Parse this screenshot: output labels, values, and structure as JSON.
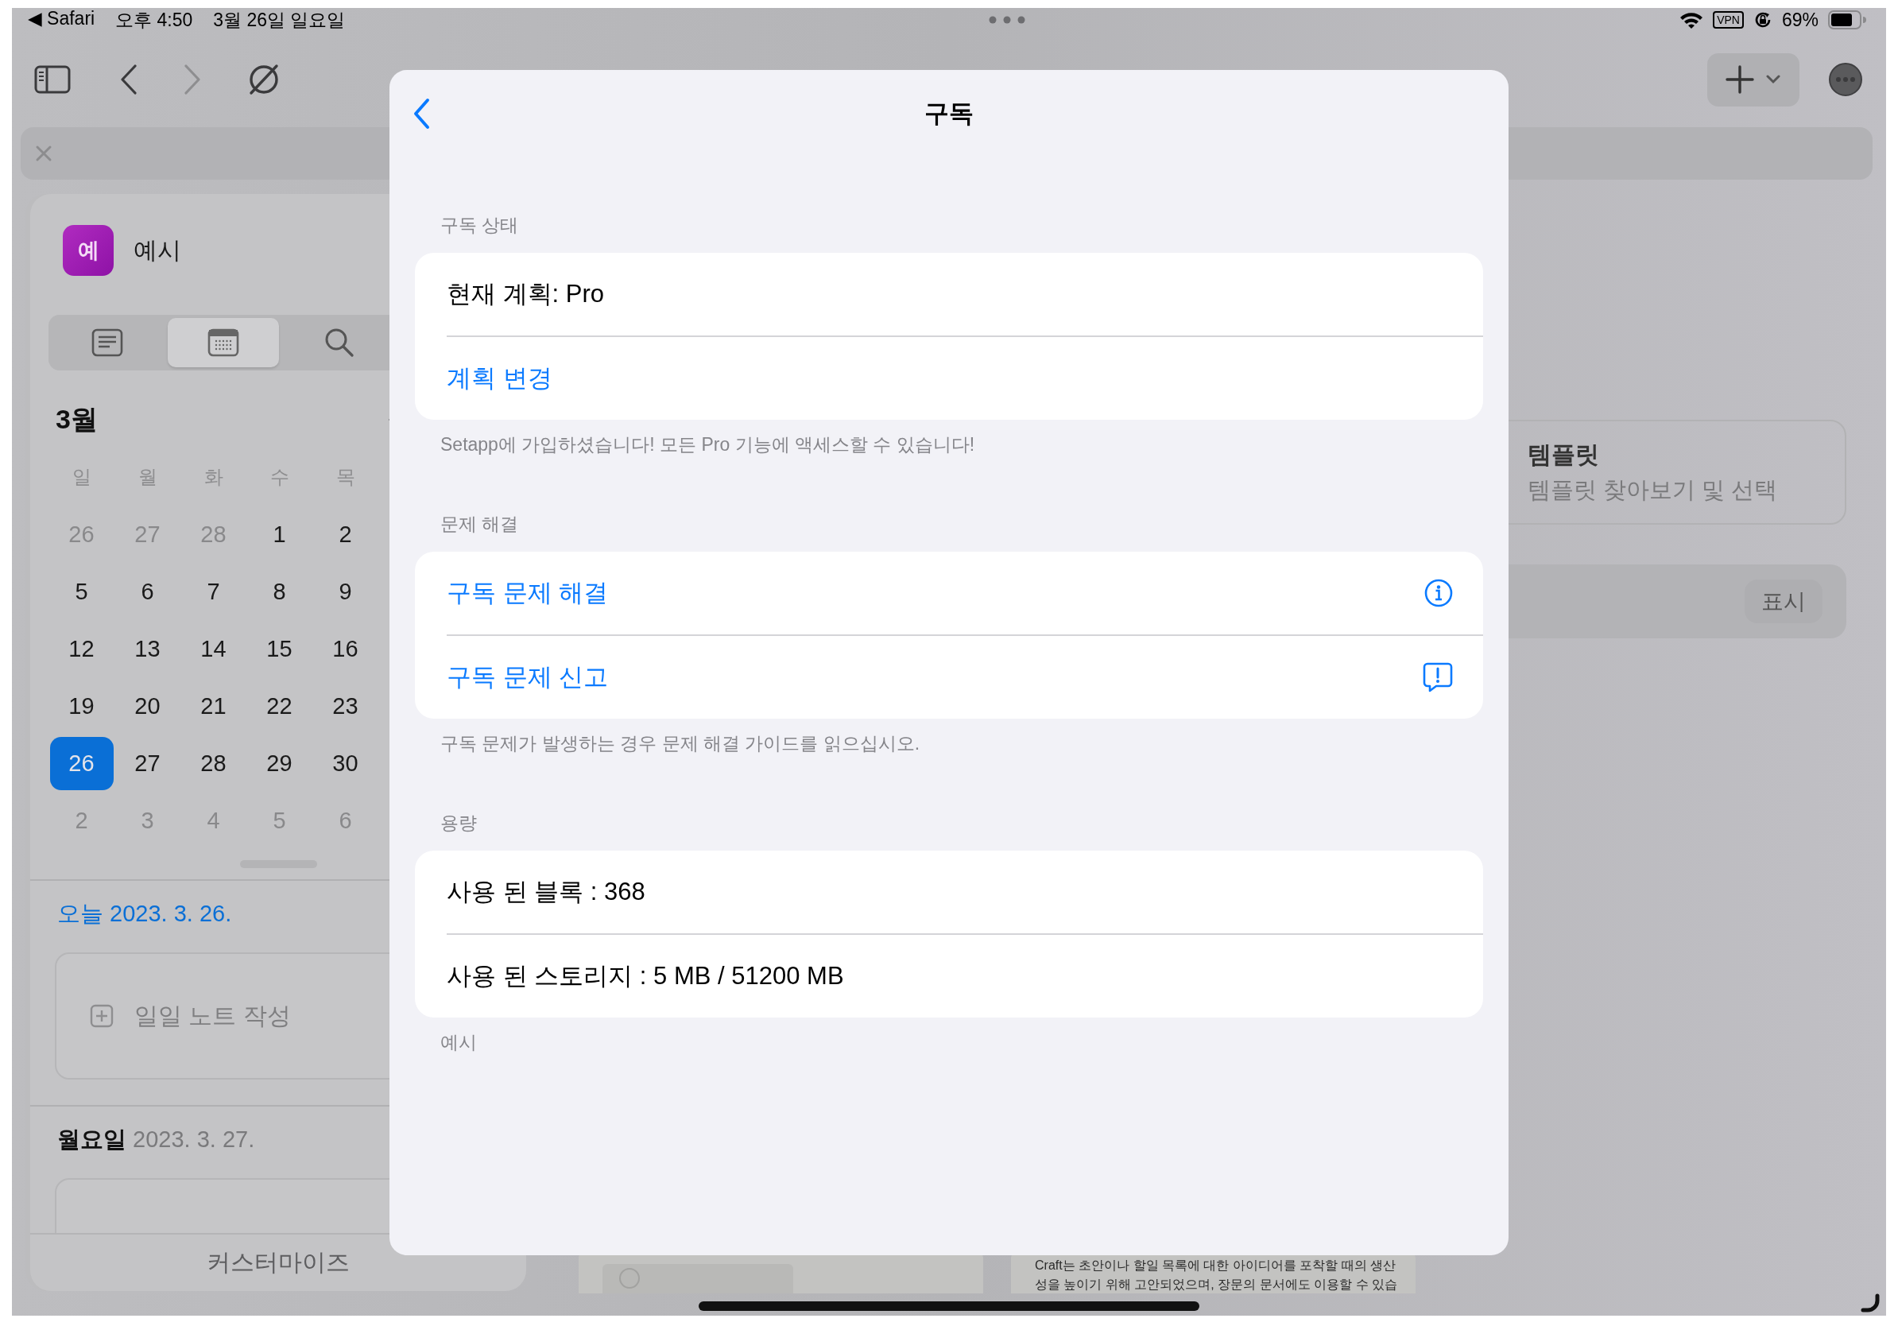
{
  "status_bar": {
    "back_app": "◀ Safari",
    "time": "오후 4:50",
    "date": "3월 26일 일요일",
    "vpn": "VPN",
    "battery": "69%"
  },
  "toolbar": {
    "back": {
      "disabled": false
    },
    "forward": {
      "disabled": true
    }
  },
  "sidebar": {
    "space": {
      "initial": "예",
      "name": "예시"
    },
    "view_tabs": [
      {
        "kind": "list",
        "selected": false
      },
      {
        "kind": "calendar",
        "selected": true
      },
      {
        "kind": "search",
        "selected": false
      }
    ],
    "calendar": {
      "month": "3월",
      "weekdays": [
        "일",
        "월",
        "화",
        "수",
        "목"
      ],
      "weeks": [
        [
          {
            "day": "26",
            "outside": true,
            "selected": false
          },
          {
            "day": "27",
            "outside": true,
            "selected": false
          },
          {
            "day": "28",
            "outside": true,
            "selected": false
          },
          {
            "day": "1",
            "outside": false,
            "selected": false
          },
          {
            "day": "2",
            "outside": false,
            "selected": false
          }
        ],
        [
          {
            "day": "5",
            "outside": false,
            "selected": false
          },
          {
            "day": "6",
            "outside": false,
            "selected": false
          },
          {
            "day": "7",
            "outside": false,
            "selected": false
          },
          {
            "day": "8",
            "outside": false,
            "selected": false
          },
          {
            "day": "9",
            "outside": false,
            "selected": false
          }
        ],
        [
          {
            "day": "12",
            "outside": false,
            "selected": false
          },
          {
            "day": "13",
            "outside": false,
            "selected": false
          },
          {
            "day": "14",
            "outside": false,
            "selected": false
          },
          {
            "day": "15",
            "outside": false,
            "selected": false
          },
          {
            "day": "16",
            "outside": false,
            "selected": false
          }
        ],
        [
          {
            "day": "19",
            "outside": false,
            "selected": false
          },
          {
            "day": "20",
            "outside": false,
            "selected": false
          },
          {
            "day": "21",
            "outside": false,
            "selected": false
          },
          {
            "day": "22",
            "outside": false,
            "selected": false
          },
          {
            "day": "23",
            "outside": false,
            "selected": false
          }
        ],
        [
          {
            "day": "26",
            "outside": false,
            "selected": true
          },
          {
            "day": "27",
            "outside": false,
            "selected": false
          },
          {
            "day": "28",
            "outside": false,
            "selected": false
          },
          {
            "day": "29",
            "outside": false,
            "selected": false
          },
          {
            "day": "30",
            "outside": false,
            "selected": false
          }
        ],
        [
          {
            "day": "2",
            "outside": true,
            "selected": false
          },
          {
            "day": "3",
            "outside": true,
            "selected": false
          },
          {
            "day": "4",
            "outside": true,
            "selected": false
          },
          {
            "day": "5",
            "outside": true,
            "selected": false
          },
          {
            "day": "6",
            "outside": true,
            "selected": false
          }
        ]
      ]
    },
    "days": [
      {
        "label": "오늘",
        "date": "2023. 3. 26.",
        "today": true,
        "note_action": "일일 노트 작성"
      },
      {
        "label": "월요일",
        "date": "2023. 3. 27.",
        "today": false
      }
    ],
    "customize": "커스터마이즈"
  },
  "background": {
    "template_card": {
      "title": "템플릿",
      "subtitle": "템플릿 찾아보기 및 선택"
    },
    "show_button": "표시",
    "preview_text": [
      "Craft는 초안이나 할일 목록에 대한 아이디어를 포착할 때의 생산",
      "성을 높이기 위해 고안되었으며, 장문의 문서에도 이용할 수 있습"
    ]
  },
  "modal": {
    "title": "구독",
    "sections": [
      {
        "header": "구독 상태",
        "rows": [
          {
            "kind": "text",
            "label": "현재 계획: Pro"
          },
          {
            "kind": "link",
            "label": "계획 변경"
          }
        ],
        "footer": "Setapp에 가입하셨습니다! 모든 Pro 기능에 액세스할 수 있습니다!"
      },
      {
        "header": "문제 해결",
        "rows": [
          {
            "kind": "info",
            "label": "구독 문제 해결"
          },
          {
            "kind": "report",
            "label": "구독 문제 신고"
          }
        ],
        "footer": "구독 문제가 발생하는 경우 문제 해결 가이드를 읽으십시오."
      },
      {
        "header": "용량",
        "rows": [
          {
            "kind": "text",
            "label": "사용 된 블록 : 368"
          },
          {
            "kind": "text",
            "label": "사용 된 스토리지 : 5 MB / 51200 MB"
          }
        ],
        "footer": "예시"
      }
    ]
  }
}
